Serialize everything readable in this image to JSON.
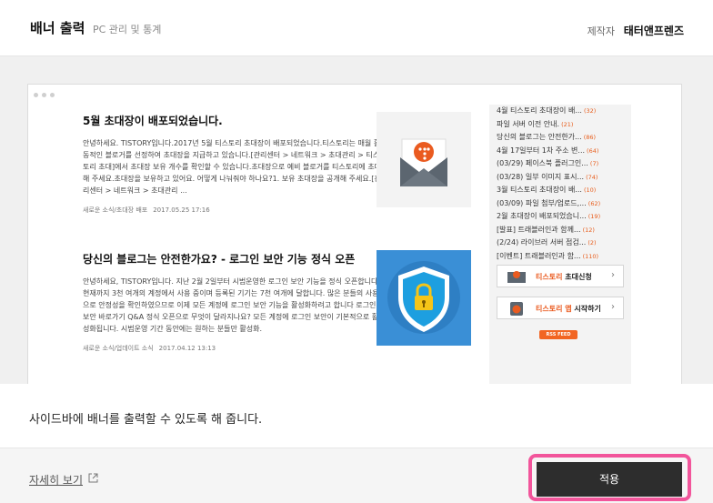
{
  "header": {
    "title": "배너 출력",
    "subtitle": "PC 관리 및 통계",
    "maker_label": "제작자",
    "maker_name": "태터앤프렌즈"
  },
  "preview": {
    "posts": [
      {
        "title": "5월 초대장이 배포되었습니다.",
        "body": "안녕하세요. TISTORY입니다.2017년 5월 티스토리 초대장이 배포되었습니다.티스토리는 매월 활동적인 블로거를 선정하여 초대장을 지급하고 있습니다.[관리센터 > 네트워크 > 초대관리 > 티스토리 초대]에서 초대장 보유 개수를 확인할 수 있습니다.초대장으로 예비 블로거를 티스토리에 초대해 주세요.초대장을 보유하고 있어요. 어떻게 나눠줘야 하나요?1. 보유 초대장을 공개해 주세요.[관리센터 > 네트워크 > 초대관리 ...",
        "category": "새로운 소식/초대장 배포",
        "date": "2017.05.25 17:16"
      },
      {
        "title": "당신의 블로그는 안전한가요? - 로그인 보안 기능 정식 오픈",
        "body": "안녕하세요, TISTORY입니다. 지난 2월 2일부터 시범운영한 로그인 보안 기능을 정식 오픈합니다. 현재까지 3천 여개의 계정에서 사용 중이며 등록된 기기는 7천 여개에 달합니다. 많은 분들의 사용으로 안정성을 확인하였으므로 이제 모든 계정에 로그인 보안 기능을 활성화하려고 합니다 로그인 보안 바로가기 Q&A 정식 오픈으로 무엇이 달라지나요? 모든 계정에 로그인 보안이 기본적으로 활성화됩니다. 시범운영 기간 동안에는 원하는 분들만 활성화.",
        "category": "새로운 소식/업데이트 소식",
        "date": "2017.04.12 13:13"
      }
    ],
    "sidebar": {
      "items": [
        {
          "text": "4월 티스토리 초대장이 배...",
          "count": "(32)"
        },
        {
          "text": "파일 서버 이전 안내.",
          "count": "(21)"
        },
        {
          "text": "당신의 블로그는 안전한가...",
          "count": "(86)"
        },
        {
          "text": "4월 17일부터 1차 주소 변...",
          "count": "(64)"
        },
        {
          "text": "(03/29) 페이스북 플러그인...",
          "count": "(7)"
        },
        {
          "text": "(03/28) 일부 이미지 표시...",
          "count": "(74)"
        },
        {
          "text": "3월 티스토리 초대장이 배...",
          "count": "(10)"
        },
        {
          "text": "(03/09) 파일 첨부/업로드,...",
          "count": "(62)"
        },
        {
          "text": "2월 초대장이 배포되었습니...",
          "count": "(19)"
        },
        {
          "text": "[발표] 트래블러인과 함께...",
          "count": "(12)"
        },
        {
          "text": "(2/24) 라이브러 서버 점검...",
          "count": "(2)"
        },
        {
          "text": "[이벤트] 트래블러인과 함...",
          "count": "(110)"
        }
      ],
      "banner_invite": {
        "brand": "티스토리",
        "rest": " 초대신청"
      },
      "banner_app": {
        "brand": "티스토리 앱",
        "rest": " 시작하기"
      },
      "rss_label": "RSS FEED"
    }
  },
  "description": "사이드바에 배너를 출력할 수 있도록 해 줍니다.",
  "footer": {
    "more_link": "자세히 보기",
    "apply_label": "적용"
  },
  "colors": {
    "accent": "#ea5b20",
    "highlight": "#f2559b",
    "button": "#2d2d2d"
  }
}
